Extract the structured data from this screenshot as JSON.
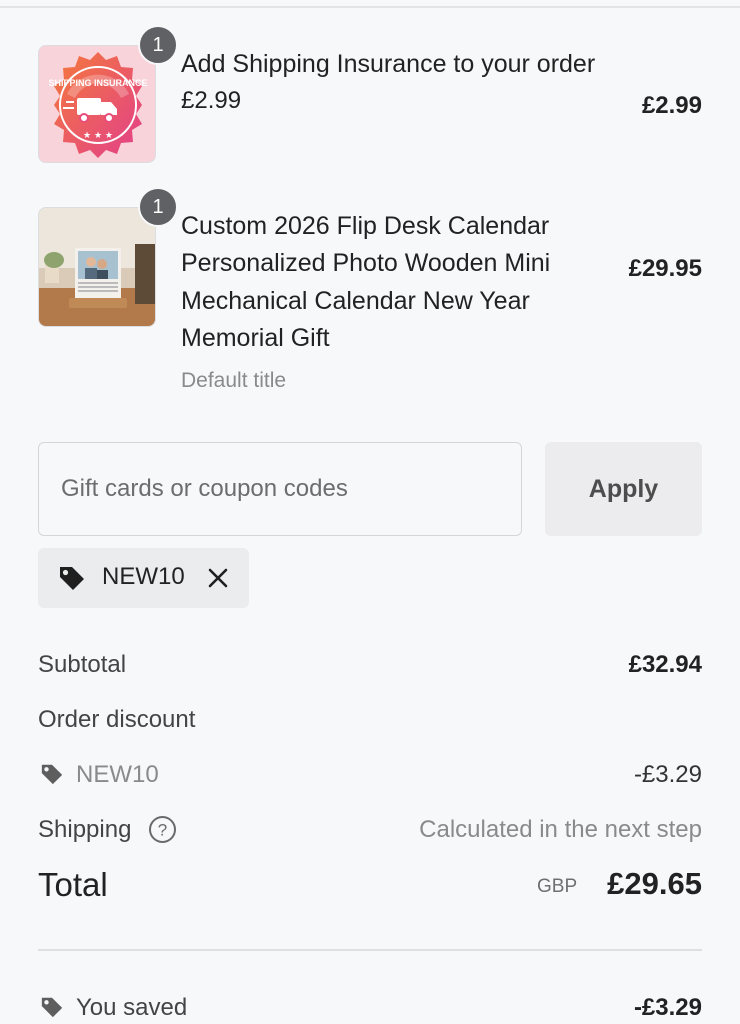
{
  "line_items": [
    {
      "quantity": "1",
      "title_lines": [
        "Add Shipping Insurance to your order"
      ],
      "subtitle": "£2.99",
      "price": "£2.99",
      "thumb_icon": "shipping-insurance-badge-icon",
      "thumb_text": "SHIPPING INSURANCE"
    },
    {
      "quantity": "1",
      "title_lines": [
        "Custom 2026 Flip Desk Calendar",
        "Personalized Photo Wooden Mini",
        "Mechanical Calendar New Year",
        "Memorial Gift"
      ],
      "variant": "Default title",
      "price": "£29.95",
      "thumb_icon": "photo-calendar-image"
    }
  ],
  "coupon": {
    "placeholder": "Gift cards or coupon codes",
    "apply_label": "Apply",
    "applied_code": "NEW10"
  },
  "summary": {
    "subtotal_label": "Subtotal",
    "subtotal_value": "£32.94",
    "discount_label": "Order discount",
    "discount_code": "NEW10",
    "discount_value": "-£3.29",
    "shipping_label": "Shipping",
    "shipping_value": "Calculated in the next step",
    "total_label": "Total",
    "currency": "GBP",
    "total_value": "£29.65",
    "saved_label": "You saved",
    "saved_value": "-£3.29"
  },
  "colors": {
    "background": "#f7f8fa",
    "badge": "#5f6164",
    "insurance_badge": "#ea4f83"
  }
}
